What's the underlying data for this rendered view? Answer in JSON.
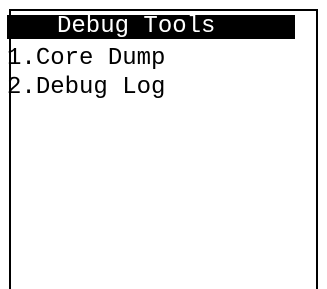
{
  "screen": {
    "title": "Debug Tools",
    "menu_items": [
      {
        "number": "1.",
        "label": "Core Dump"
      },
      {
        "number": "2.",
        "label": "Debug Log"
      }
    ]
  },
  "colors": {
    "background": "#ffffff",
    "foreground": "#000000",
    "title_bar_background": "#000000",
    "title_bar_text": "#ffffff"
  }
}
